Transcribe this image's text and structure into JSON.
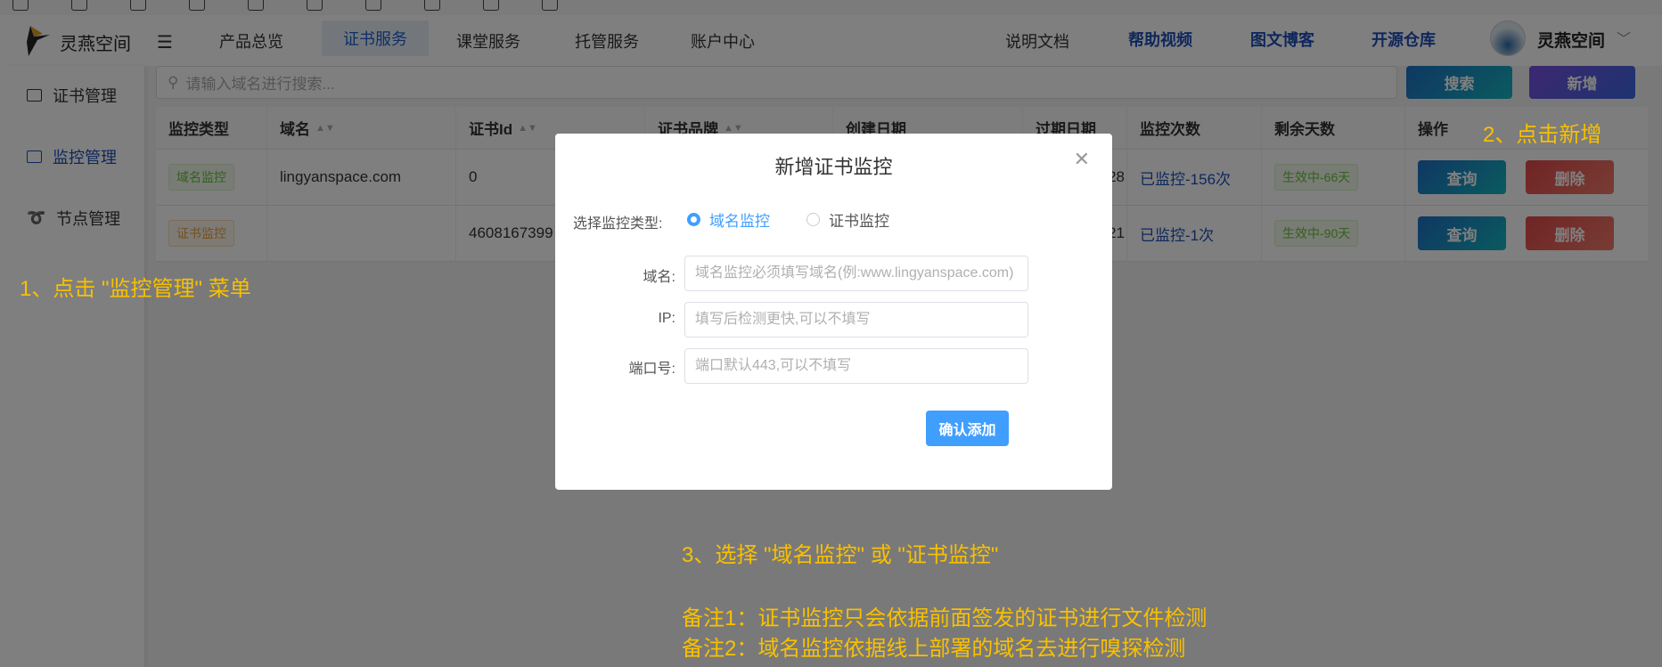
{
  "header": {
    "brand": "灵燕空间",
    "nav": [
      "产品总览",
      "证书服务",
      "课堂服务",
      "托管服务",
      "账户中心"
    ],
    "active_nav": "证书服务",
    "docs": "说明文档",
    "links": [
      "帮助视频",
      "图文博客",
      "开源仓库"
    ],
    "user": "灵燕空间"
  },
  "sidebar": {
    "items": [
      {
        "label": "证书管理",
        "icon": "certificate-icon"
      },
      {
        "label": "监控管理",
        "icon": "monitor-icon"
      },
      {
        "label": "节点管理",
        "icon": "link-icon"
      }
    ],
    "active": "监控管理"
  },
  "toolbar": {
    "search_placeholder": "请输入域名进行搜索...",
    "search_label": "搜索",
    "add_label": "新增"
  },
  "table": {
    "columns": [
      "监控类型",
      "域名",
      "证书Id",
      "证书品牌",
      "创建日期",
      "过期日期",
      "监控次数",
      "剩余天数",
      "操作"
    ],
    "rows": [
      {
        "type": "域名监控",
        "domain": "lingyanspace.com",
        "cert_id": "0",
        "expiry_tail": "28",
        "count": "已监控-156次",
        "remain": "生效中-66天",
        "query": "查询",
        "delete": "删除"
      },
      {
        "type": "证书监控",
        "domain": "",
        "cert_id": "4608167399",
        "expiry_tail": "21",
        "count": "已监控-1次",
        "remain": "生效中-90天",
        "query": "查询",
        "delete": "删除"
      }
    ]
  },
  "modal": {
    "title": "新增证书监控",
    "type_label": "选择监控类型:",
    "options": [
      "域名监控",
      "证书监控"
    ],
    "selected": "域名监控",
    "fields": [
      {
        "label": "域名:",
        "placeholder": "域名监控必须填写域名(例:www.lingyanspace.com)"
      },
      {
        "label": "IP:",
        "placeholder": "填写后检测更快,可以不填写"
      },
      {
        "label": "端口号:",
        "placeholder": "端口默认443,可以不填写"
      }
    ],
    "submit": "确认添加"
  },
  "annotations": {
    "step1": "1、点击 \"监控管理\" 菜单",
    "step2": "2、点击新增",
    "step3": "3、选择 \"域名监控\" 或 \"证书监控\"",
    "note1": "备注1：证书监控只会依据前面签发的证书进行文件检测",
    "note2": "备注2：域名监控依据线上部署的域名去进行嗅探检测"
  },
  "colors": {
    "accent": "#409eff",
    "annotation": "#f8c000",
    "link": "#1e4fb8"
  }
}
